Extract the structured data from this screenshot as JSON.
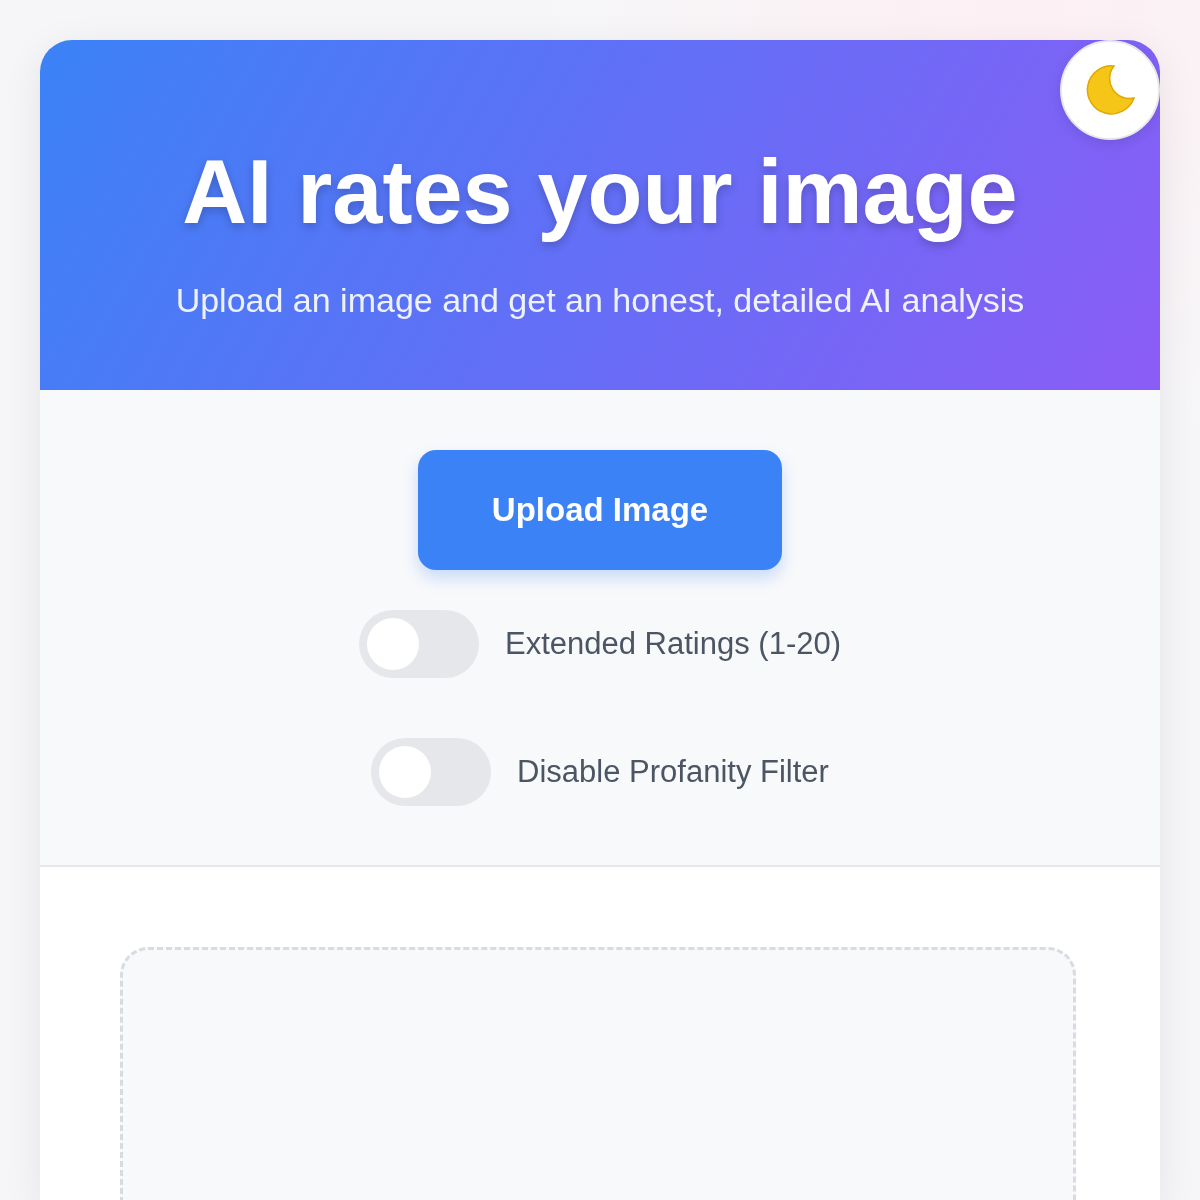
{
  "header": {
    "title": "AI rates your image",
    "subtitle": "Upload an image and get an honest, detailed AI analysis"
  },
  "upload_button": {
    "label": "Upload Image"
  },
  "toggles": [
    {
      "label": "Extended Ratings (1-20)",
      "on": false
    },
    {
      "label": "Disable Profanity Filter",
      "on": false
    }
  ]
}
